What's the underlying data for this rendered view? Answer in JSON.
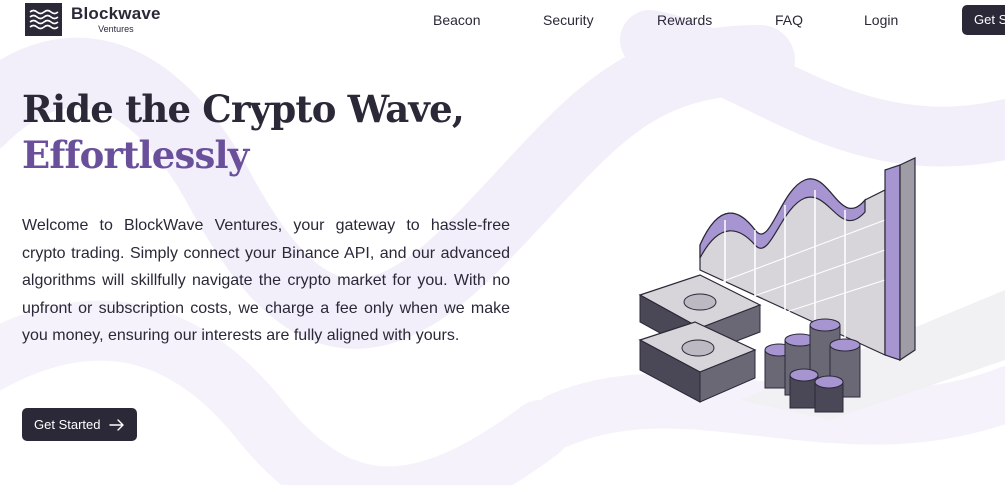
{
  "brand": {
    "name": "Blockwave",
    "sub": "Ventures"
  },
  "nav": {
    "items": [
      {
        "label": "Beacon"
      },
      {
        "label": "Security"
      },
      {
        "label": "Rewards"
      },
      {
        "label": "FAQ"
      },
      {
        "label": "Login"
      }
    ],
    "cta_label": "Get S"
  },
  "hero": {
    "title_line1": "Ride the Crypto Wave,",
    "title_line2": "Effortlessly",
    "description": "Welcome to BlockWave Ventures, your gateway to hassle-free crypto trading. Simply connect your Binance API, and our advanced algorithms will skillfully navigate the crypto market for you. With no upfront or subscription costs, we charge a fee only when we make you money, ensuring our interests are fully aligned with yours.",
    "cta_label": "Get Started"
  },
  "colors": {
    "dark": "#2b2838",
    "accent": "#6a4f9b",
    "wave": "#f2effa",
    "chart_purple": "#a795d1"
  },
  "icons": {
    "logo": "wave-lines-icon",
    "cta": "arrow-right-icon"
  }
}
